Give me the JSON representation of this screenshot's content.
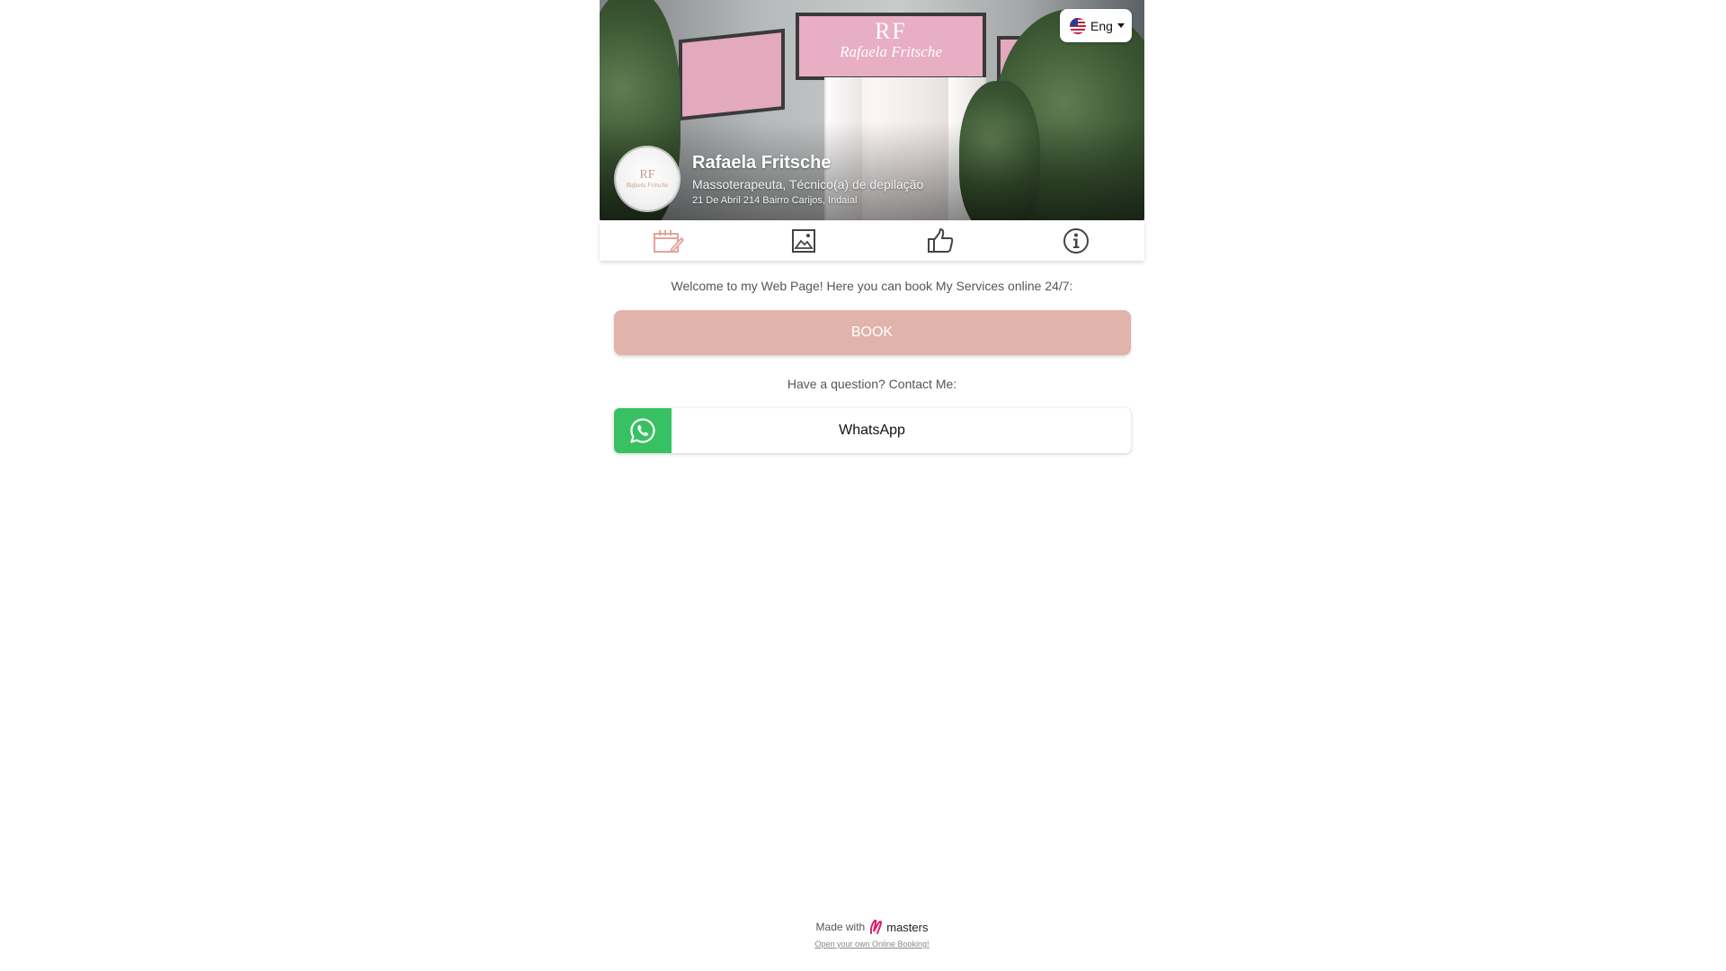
{
  "language": {
    "label": "Eng",
    "flag_icon": "us-flag-icon"
  },
  "profile": {
    "avatar_monogram": "RF",
    "avatar_name": "Rafaela Fritsche",
    "name": "Rafaela Fritsche",
    "subtitle": "Massoterapeuta, Técnico(a) de depilação",
    "address": "21 De Abril 214 Bairro Carijos, Indaial"
  },
  "cover": {
    "sign_monogram": "RF",
    "sign_name": "Rafaela Fritsche"
  },
  "tabs": [
    {
      "icon": "calendar-edit-icon",
      "active": true
    },
    {
      "icon": "image-icon",
      "active": false
    },
    {
      "icon": "thumbs-up-icon",
      "active": false
    },
    {
      "icon": "info-icon",
      "active": false
    }
  ],
  "main": {
    "welcome_text": "Welcome to my Web Page! Here you can book My Services online 24/7:",
    "book_label": "BOOK",
    "question_text": "Have a question? Contact Me:",
    "whatsapp_label": "WhatsApp"
  },
  "footer": {
    "made_with": "Made with",
    "brand": "masters",
    "promo_link": "Open your own Online Booking!"
  },
  "colors": {
    "accent": "#e0b3ab",
    "active_icon": "#e3a49a",
    "whatsapp_green": "#37c162"
  }
}
